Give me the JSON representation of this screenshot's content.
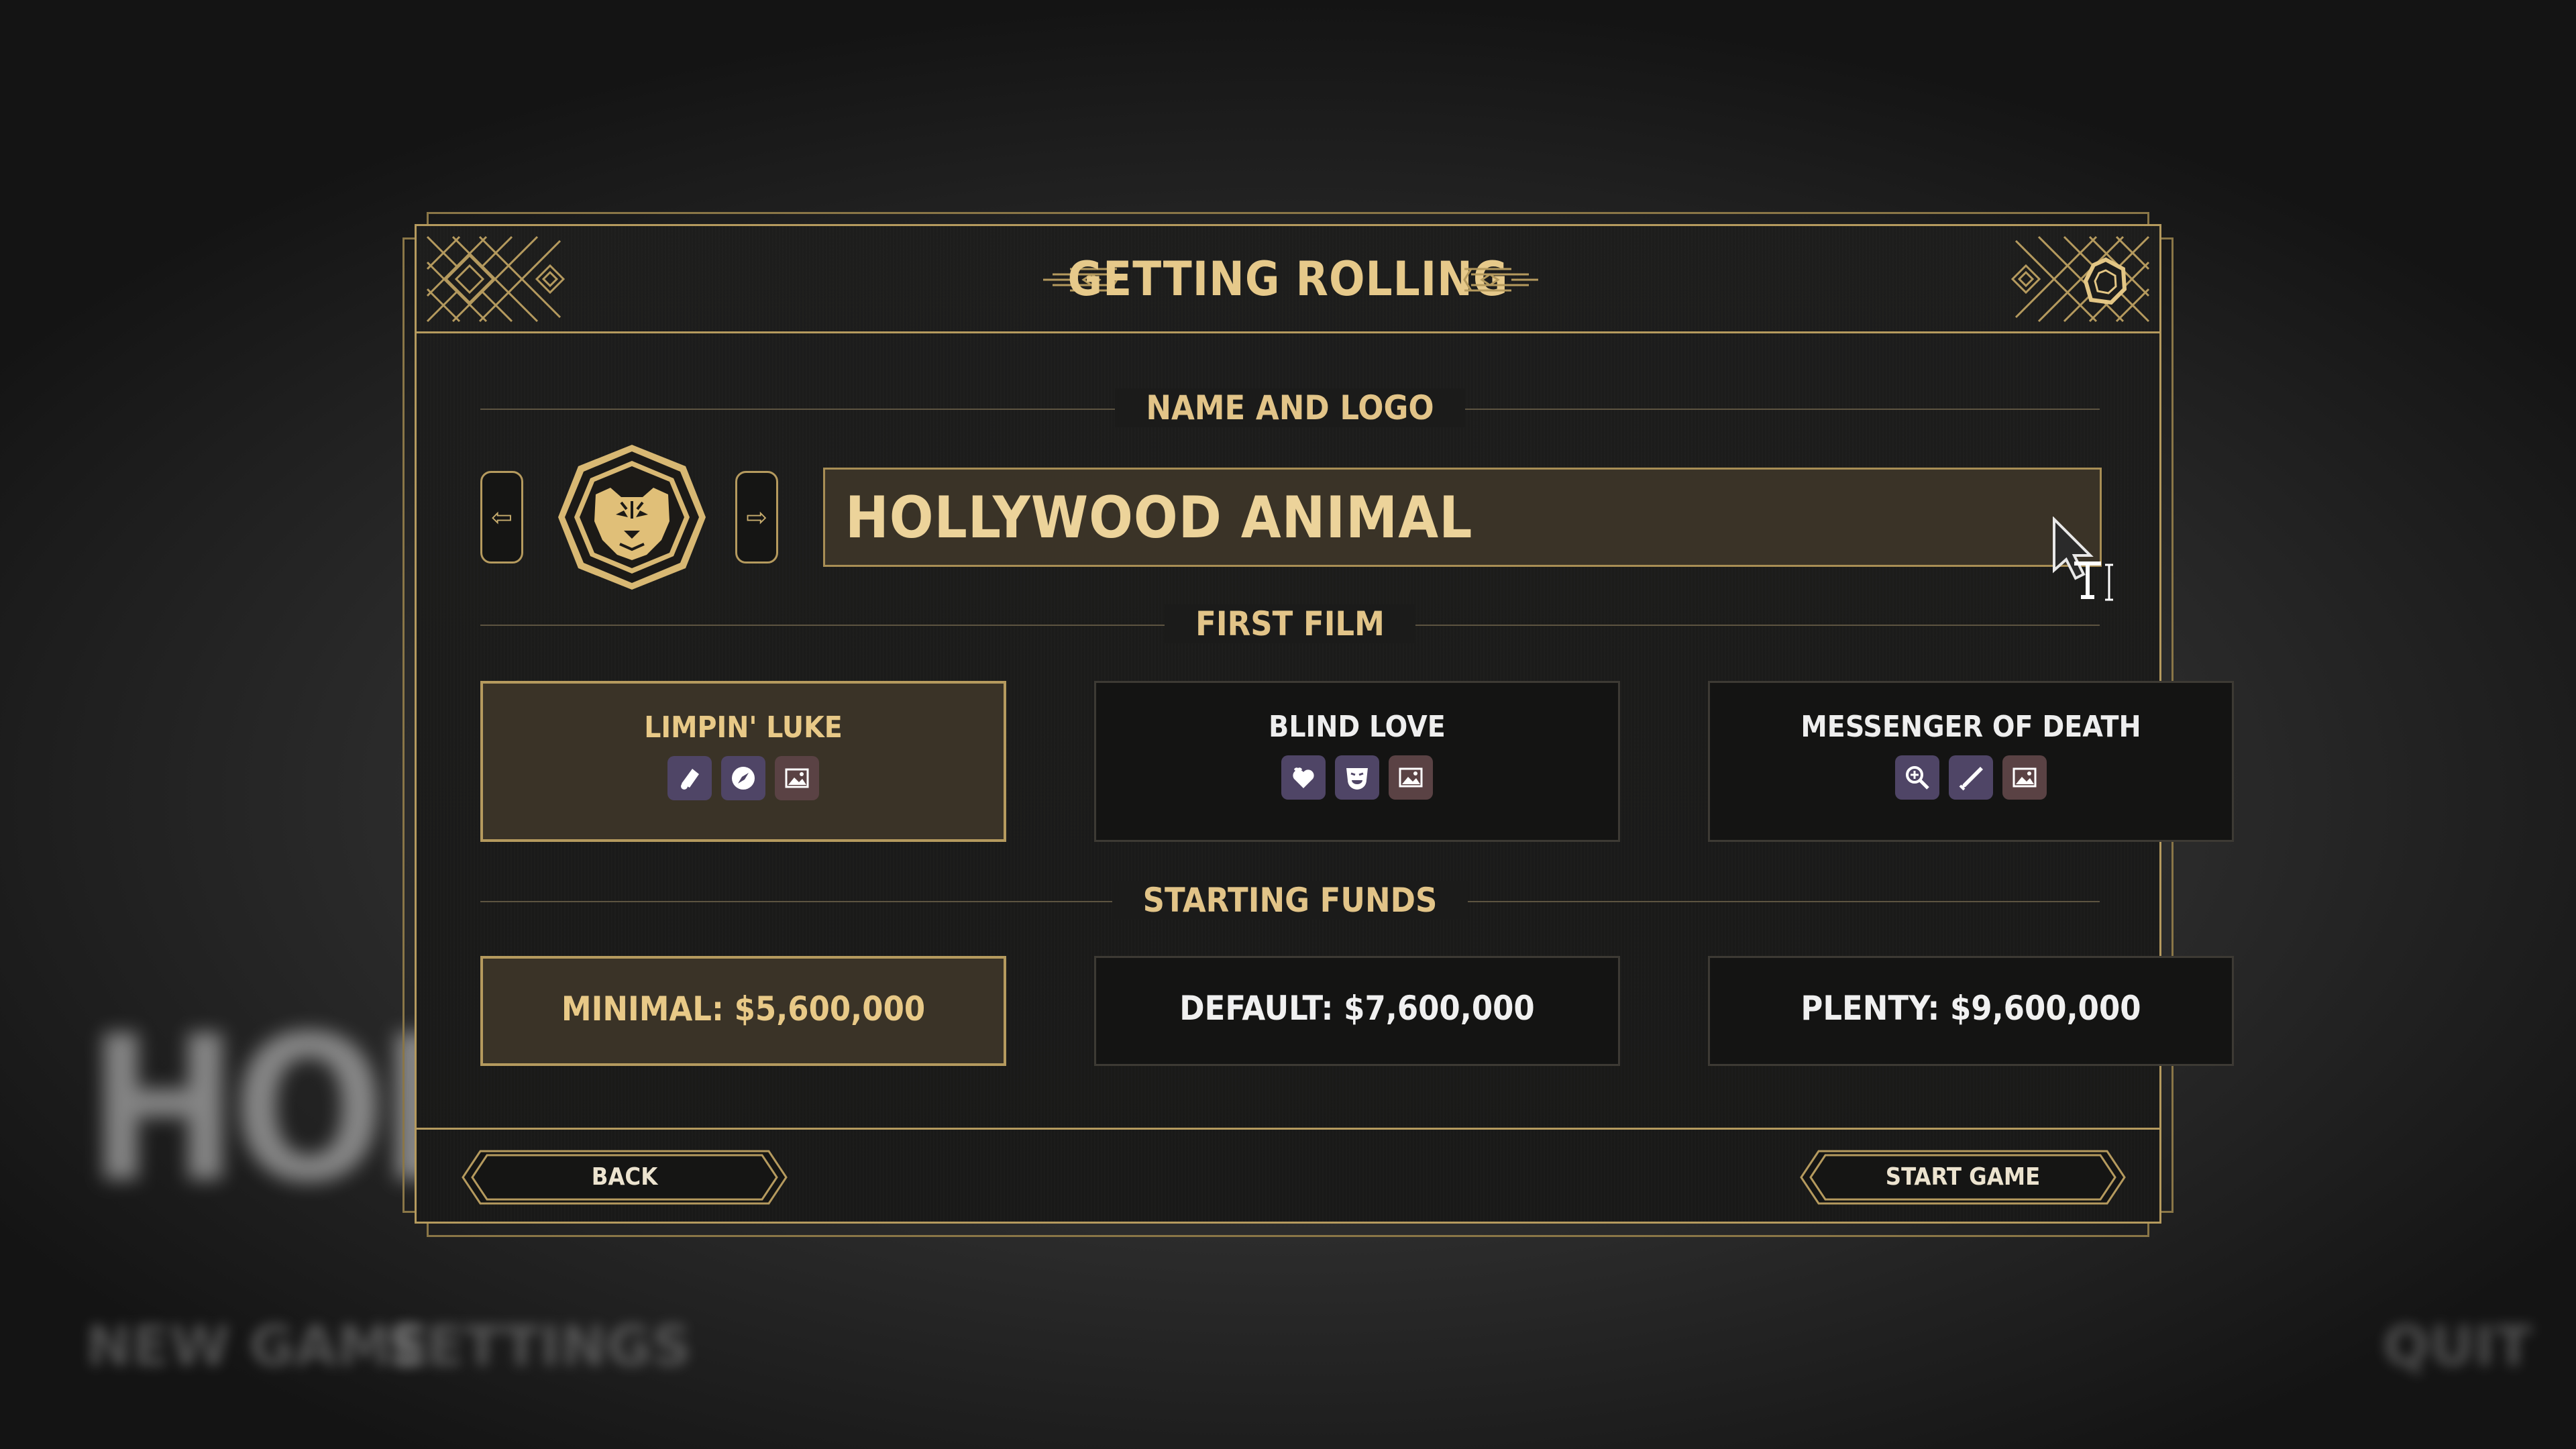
{
  "background": {
    "title_text": "HOLLYW",
    "menu": [
      "NEW GAME",
      "SETTINGS",
      "QUIT"
    ]
  },
  "dialog": {
    "title": "GETTING ROLLING",
    "name_section": {
      "label": "NAME AND LOGO",
      "studio_name": "HOLLYWOOD ANIMAL",
      "logo_icon": "tiger-head-icon",
      "prev_icon": "arrow-left-icon",
      "next_icon": "arrow-right-icon"
    },
    "film_section": {
      "label": "FIRST FILM",
      "films": [
        {
          "title": "LIMPIN' LUKE",
          "selected": true,
          "genres": [
            "western-icon",
            "adventure-icon",
            "art-icon"
          ]
        },
        {
          "title": "BLIND LOVE",
          "selected": false,
          "genres": [
            "romance-icon",
            "drama-icon",
            "art-icon"
          ]
        },
        {
          "title": "MESSENGER OF DEATH",
          "selected": false,
          "genres": [
            "detective-icon",
            "action-icon",
            "art-icon"
          ]
        }
      ]
    },
    "funds_section": {
      "label": "STARTING FUNDS",
      "options": [
        {
          "label": "MINIMAL: $5,600,000",
          "selected": true
        },
        {
          "label": "DEFAULT: $7,600,000",
          "selected": false
        },
        {
          "label": "PLENTY: $9,600,000",
          "selected": false
        }
      ]
    },
    "footer": {
      "back_label": "BACK",
      "start_label": "START GAME"
    }
  },
  "colors": {
    "gold": "#b59a5e",
    "gold_text": "#e6c98a",
    "genre_purple": "#4f4566",
    "genre_brown": "#5a4244",
    "selected_bg": "#3a3327"
  }
}
